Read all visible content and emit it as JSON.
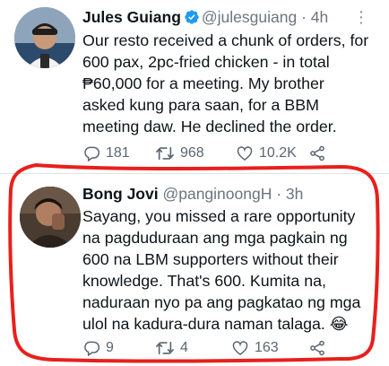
{
  "tweets": [
    {
      "name": "Jules Guiang",
      "handle": "@julesguiang",
      "time": "· 4h",
      "verified": true,
      "lines": [
        "Our resto received a chunk of orders, for",
        "600 pax, 2pc-fried chicken - in total",
        "₱60,000 for a meeting. My brother",
        "asked kung para saan, for a BBM",
        "meeting daw. He declined the order."
      ],
      "replies": "181",
      "retweets": "968",
      "likes": "10.2K"
    },
    {
      "name": "Bong Jovi",
      "handle": "@panginoongH",
      "time": "· 3h",
      "verified": false,
      "lines": [
        "Sayang, you missed a rare opportunity",
        "na pagduduraan ang mga pagkain ng",
        "600 na LBM supporters without their",
        "knowledge. That's 600. Kumita na,",
        "naduraan nyo pa ang pagkatao ng mga",
        "ulol na kadura-dura naman talaga. 😂"
      ],
      "replies": "9",
      "retweets": "4",
      "likes": "163"
    }
  ],
  "colors": {
    "verified": "#1d9bf0",
    "annotation": "#e8201c",
    "icon": "#5b6670"
  },
  "icons": [
    "verified-badge-icon",
    "more-icon",
    "reply-icon",
    "retweet-icon",
    "like-icon",
    "share-icon"
  ]
}
